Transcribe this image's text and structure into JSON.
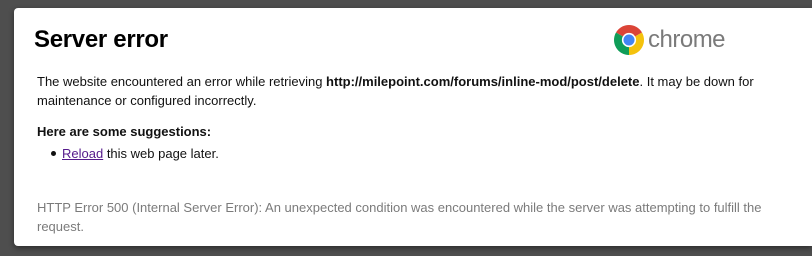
{
  "title": "Server error",
  "brand": {
    "wordmark": "chrome",
    "icon": "chrome-logo-icon",
    "colors": {
      "red": "#db4437",
      "yellow": "#f4c20d",
      "green": "#0f9d58",
      "blue": "#4285f4"
    }
  },
  "message": {
    "before": "The website encountered an error while retrieving ",
    "url": "http://milepoint.com/forums/inline-mod/post/delete",
    "after": ". It may be down for maintenance or configured incorrectly."
  },
  "suggestions": {
    "heading": "Here are some suggestions:",
    "items": [
      {
        "link": "Reload",
        "rest": " this web page later."
      }
    ]
  },
  "error_detail": "HTTP Error 500 (Internal Server Error): An unexpected condition was encountered while the server was attempting to fulfill the request.",
  "colors": {
    "background": "#4e4e4e",
    "card": "#ffffff",
    "link": "#551a8b",
    "muted_text": "#7b7b7b"
  }
}
